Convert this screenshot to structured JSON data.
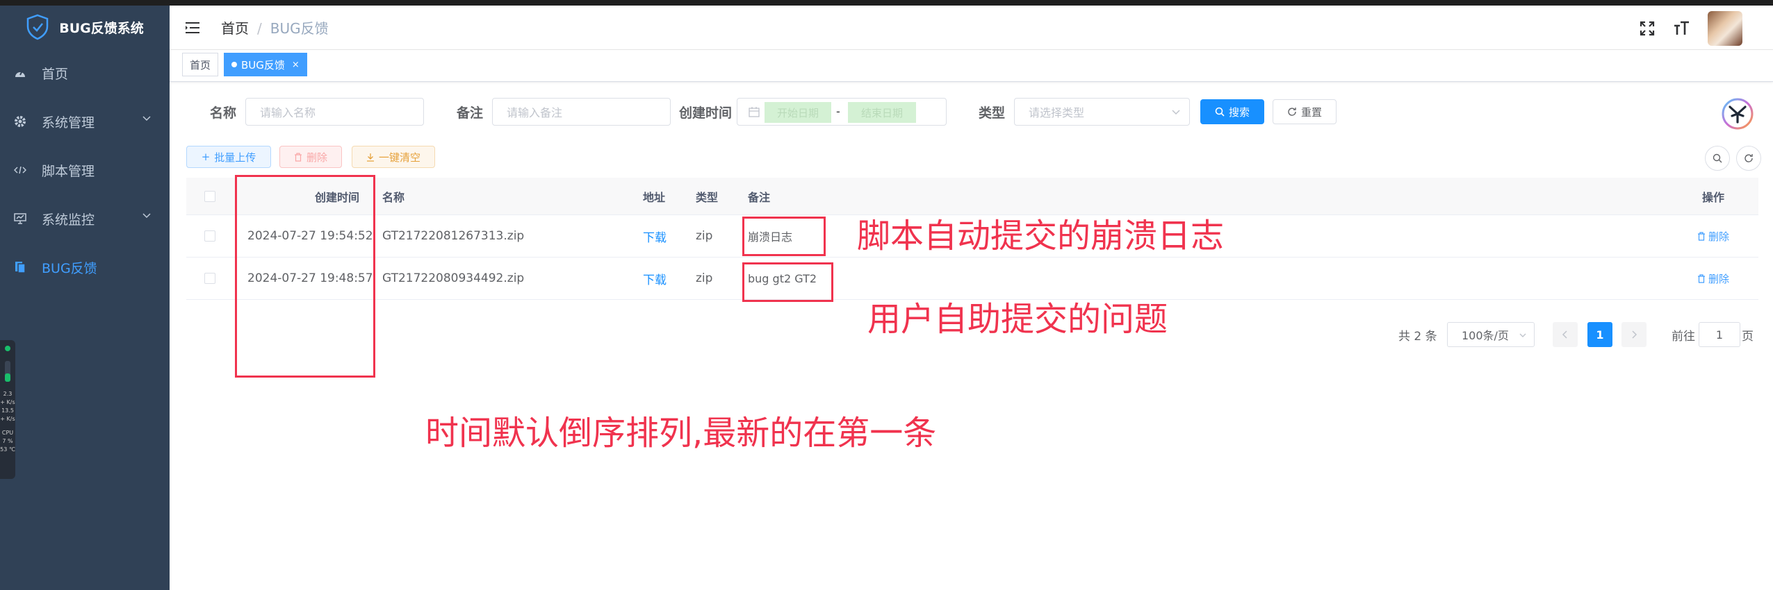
{
  "app": {
    "title": "BUG反馈系统"
  },
  "sidebar": {
    "items": [
      {
        "label": "首页",
        "icon": "dashboard-icon",
        "has_arrow": false,
        "active": false
      },
      {
        "label": "系统管理",
        "icon": "gear-icon",
        "has_arrow": true,
        "active": false
      },
      {
        "label": "脚本管理",
        "icon": "code-icon",
        "has_arrow": false,
        "active": false
      },
      {
        "label": "系统监控",
        "icon": "monitor-icon",
        "has_arrow": true,
        "active": false
      },
      {
        "label": "BUG反馈",
        "icon": "document-icon",
        "has_arrow": false,
        "active": true
      }
    ]
  },
  "monitor_widget": {
    "l1": "2.3",
    "l2": "+ K/s",
    "l3": "13.5",
    "l4": "+ K/s",
    "l5": "CPU",
    "l6": "7 %",
    "l7": "53 ℃"
  },
  "breadcrumb": {
    "home": "首页",
    "current": "BUG反馈"
  },
  "tags": {
    "home": "首页",
    "current": "BUG反馈",
    "close": "×"
  },
  "search": {
    "name_label": "名称",
    "name_placeholder": "请输入名称",
    "remark_label": "备注",
    "remark_placeholder": "请输入备注",
    "time_label": "创建时间",
    "start_placeholder": "开始日期",
    "range_sep": "-",
    "end_placeholder": "结束日期",
    "type_label": "类型",
    "type_placeholder": "请选择类型",
    "search_btn": "搜索",
    "reset_btn": "重置"
  },
  "toolbar": {
    "upload": "批量上传",
    "delete": "删除",
    "clear": "一键清空"
  },
  "table": {
    "headers": {
      "time": "创建时间",
      "name": "名称",
      "addr": "地址",
      "type": "类型",
      "remark": "备注",
      "ops": "操作"
    },
    "rows": [
      {
        "time": "2024-07-27 19:54:52",
        "name": "GT21722081267313.zip",
        "addr": "下载",
        "type": "zip",
        "remark": "崩溃日志",
        "op": "删除"
      },
      {
        "time": "2024-07-27 19:48:57",
        "name": "GT21722080934492.zip",
        "addr": "下载",
        "type": "zip",
        "remark": "bug gt2 GT2",
        "op": "删除"
      }
    ]
  },
  "pagination": {
    "total": "共 2 条",
    "page_size": "100条/页",
    "current": "1",
    "goto": "前往",
    "goto_value": "1",
    "page_suffix": "页"
  },
  "annotations": {
    "crash_note": "脚本自动提交的崩溃日志",
    "user_note": "用户自助提交的问题",
    "sort_note": "时间默认倒序排列,最新的在第一条"
  },
  "colors": {
    "sidebar_bg": "#304156",
    "primary": "#1890ff",
    "annotation": "#f0334e"
  }
}
